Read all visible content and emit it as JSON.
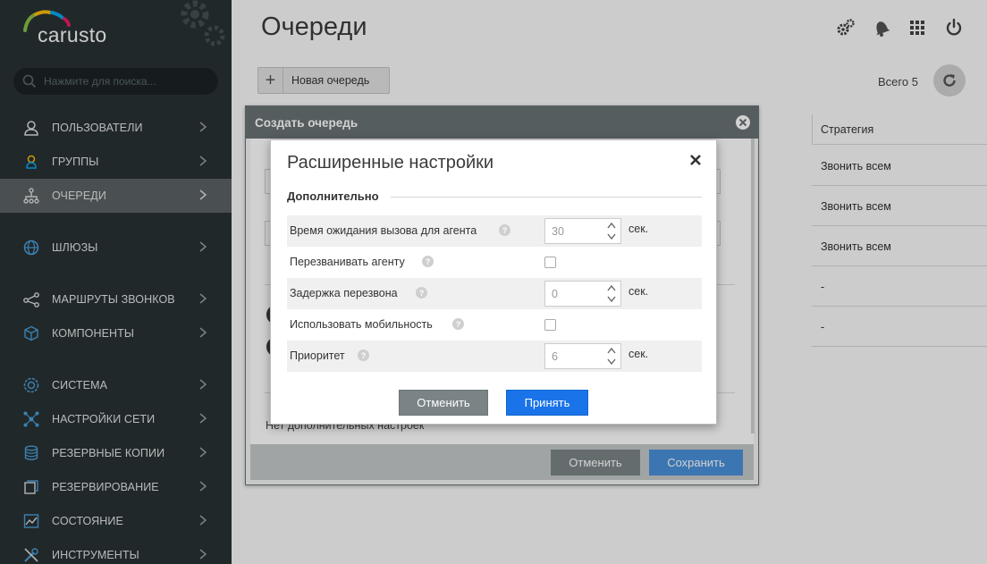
{
  "app": {
    "logo_text": "carusto"
  },
  "search": {
    "placeholder": "Нажмите для поиска..."
  },
  "sidebar": {
    "items": [
      {
        "label": "ПОЛЬЗОВАТЕЛИ",
        "icon": "user-icon"
      },
      {
        "label": "ГРУППЫ",
        "icon": "group-icon"
      },
      {
        "label": "ОЧЕРЕДИ",
        "icon": "queue-icon",
        "active": true
      },
      {
        "label": "ШЛЮЗЫ",
        "icon": "globe-icon"
      },
      {
        "label": "МАРШРУТЫ ЗВОНКОВ",
        "icon": "share-icon"
      },
      {
        "label": "КОМПОНЕНТЫ",
        "icon": "cube-icon"
      },
      {
        "label": "СИСТЕМА",
        "icon": "system-icon"
      },
      {
        "label": "НАСТРОЙКИ СЕТИ",
        "icon": "network-icon"
      },
      {
        "label": "РЕЗЕРВНЫЕ КОПИИ",
        "icon": "database-icon"
      },
      {
        "label": "РЕЗЕРВИРОВАНИЕ",
        "icon": "copy-icon"
      },
      {
        "label": "СОСТОЯНИЕ",
        "icon": "chart-icon"
      },
      {
        "label": "ИНСТРУМЕНТЫ",
        "icon": "tools-icon"
      }
    ]
  },
  "main": {
    "title": "Очереди",
    "new_queue_label": "Новая очередь",
    "total_label": "Всего 5",
    "table": {
      "strategy_header": "Стратегия",
      "strategies": [
        "Звонить всем",
        "Звонить всем",
        "Звонить всем",
        "-",
        "-"
      ]
    }
  },
  "create_modal": {
    "title": "Создать очередь",
    "no_additional": "Нет дополнительных настроек",
    "cancel_label": "Отменить",
    "save_label": "Сохранить"
  },
  "advanced_modal": {
    "title": "Расширенные настройки",
    "section": "Дополнительно",
    "rows": [
      {
        "label": "Время ожидания вызова для агента",
        "type": "number",
        "value": "30",
        "unit": "сек."
      },
      {
        "label": "Перезванивать агенту",
        "type": "checkbox",
        "checked": false
      },
      {
        "label": "Задержка перезвона",
        "type": "number",
        "value": "0",
        "unit": "сек."
      },
      {
        "label": "Использовать мобильность",
        "type": "checkbox",
        "checked": false
      },
      {
        "label": "Приоритет",
        "type": "number",
        "value": "6",
        "unit": "сек."
      }
    ],
    "cancel_label": "Отменить",
    "accept_label": "Принять"
  },
  "colors": {
    "sidebar_bg": "#2a3235",
    "accent_blue": "#1a73e8",
    "header_grey": "#697275"
  }
}
